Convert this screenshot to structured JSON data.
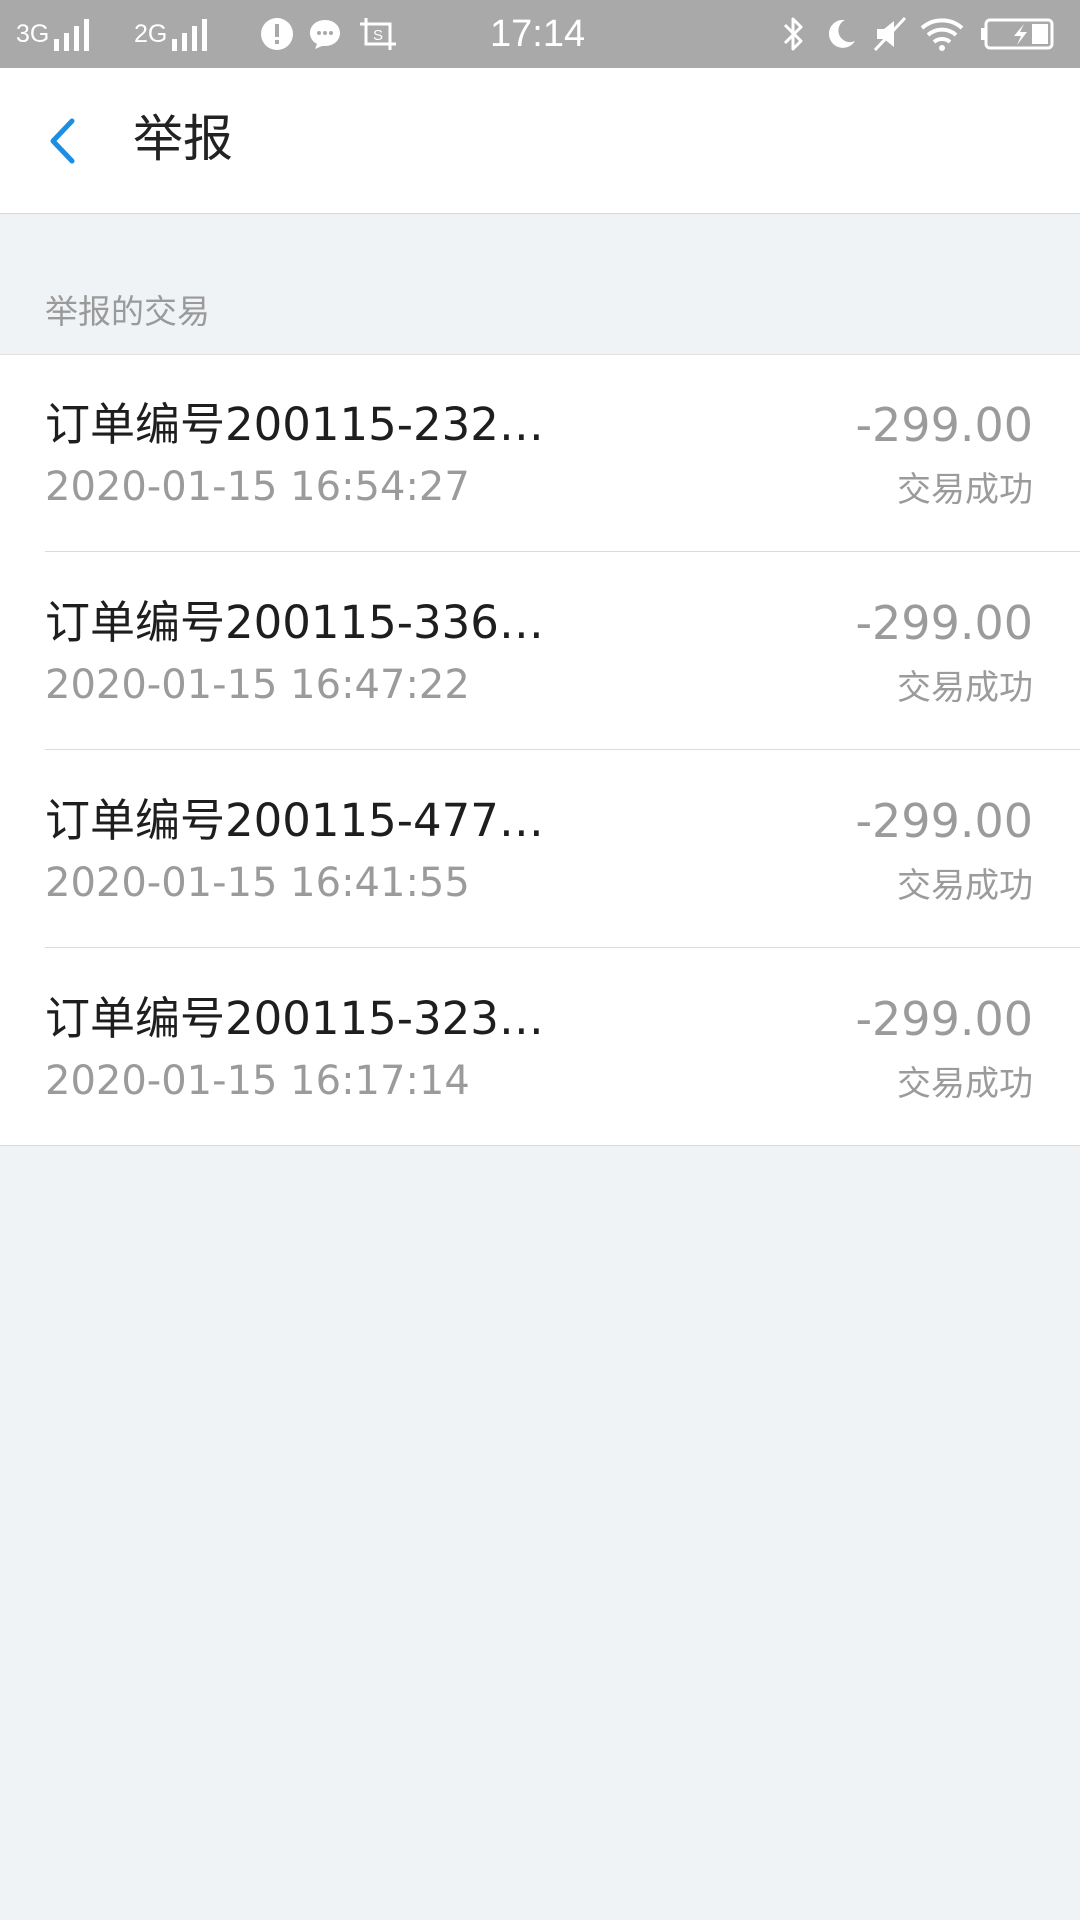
{
  "status_bar": {
    "network1": "3G",
    "network2": "2G",
    "time": "17:14",
    "icons": [
      "alert-icon",
      "chat-icon",
      "screenshot-icon",
      "bluetooth-icon",
      "moon-icon",
      "mute-icon",
      "wifi-icon",
      "battery-icon"
    ]
  },
  "header": {
    "back_icon": "chevron-left-icon",
    "title": "举报",
    "accent_color": "#1a8fe3"
  },
  "section": {
    "label": "举报的交易"
  },
  "transactions": [
    {
      "name": "订单编号200115-232…",
      "time": "2020-01-15 16:54:27",
      "amount": "-299.00",
      "status": "交易成功"
    },
    {
      "name": "订单编号200115-336…",
      "time": "2020-01-15 16:47:22",
      "amount": "-299.00",
      "status": "交易成功"
    },
    {
      "name": "订单编号200115-477…",
      "time": "2020-01-15 16:41:55",
      "amount": "-299.00",
      "status": "交易成功"
    },
    {
      "name": "订单编号200115-323…",
      "time": "2020-01-15 16:17:14",
      "amount": "-299.00",
      "status": "交易成功"
    }
  ]
}
